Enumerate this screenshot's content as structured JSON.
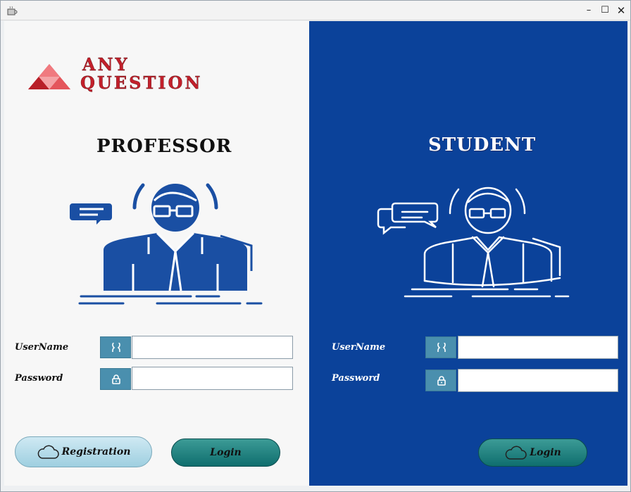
{
  "window": {
    "controls": {
      "minimize": "–",
      "maximize": "☐",
      "close": "✕"
    }
  },
  "brand": {
    "line1": "ANY",
    "line2": "QUESTION",
    "logo_icon": "red-triangle-logo",
    "color": "#c3202b"
  },
  "professor": {
    "title": "PROFESSOR",
    "username_label": "UserName",
    "password_label": "Password",
    "username_value": "",
    "password_value": "",
    "registration_label": "Registration",
    "login_label": "Login",
    "accent": "#1a4fa3"
  },
  "student": {
    "title": "STUDENT",
    "username_label": "UserName",
    "password_label": "Password",
    "username_value": "",
    "password_value": "",
    "login_label": "Login",
    "panel_color": "#0b429a"
  },
  "icons": {
    "user": "user-icon",
    "lock": "lock-icon",
    "cloud": "cloud-icon"
  }
}
